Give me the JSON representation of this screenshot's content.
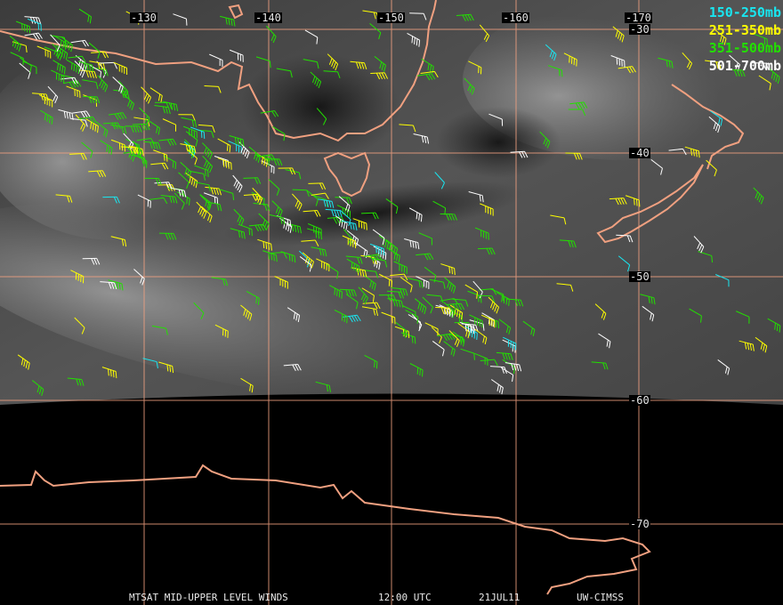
{
  "map": {
    "longitude_labels": [
      "-130",
      "-140",
      "-150",
      "-160",
      "-170"
    ],
    "latitude_labels": [
      "-30",
      "-40",
      "-50",
      "-60",
      "-70"
    ],
    "legend": [
      {
        "label": "150-250mb",
        "color": "#19e6f0"
      },
      {
        "label": "251-350mb",
        "color": "#ffff00"
      },
      {
        "label": "351-500mb",
        "color": "#22e000"
      },
      {
        "label": "501-700mb",
        "color": "#ffffff"
      }
    ],
    "gridline_color": "#f0a080",
    "coastline_color": "#f0a080"
  },
  "footer": {
    "product": "MTSAT MID-UPPER LEVEL WINDS",
    "time": "12:00 UTC",
    "date": "21JUL11",
    "source": "UW-CIMSS"
  }
}
